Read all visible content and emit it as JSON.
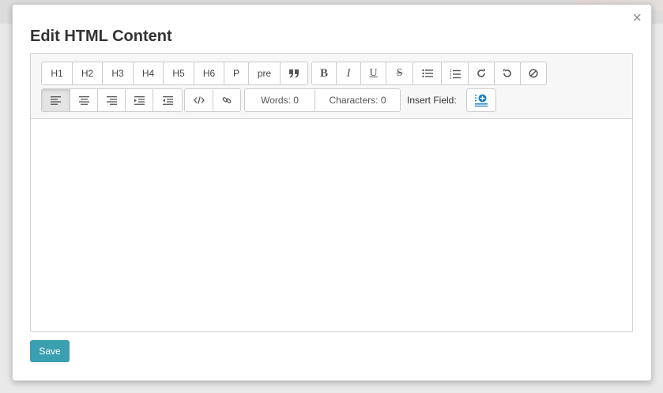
{
  "modal": {
    "title": "Edit HTML Content",
    "close_glyph": "×"
  },
  "toolbar": {
    "headings": [
      "H1",
      "H2",
      "H3",
      "H4",
      "H5",
      "H6",
      "P",
      "pre"
    ],
    "blockquote_icon": "quote-icon",
    "format_icons": [
      "bold-icon",
      "italic-icon",
      "underline-icon",
      "strikethrough-icon",
      "bullet-list-icon",
      "numbered-list-icon",
      "redo-icon",
      "undo-icon",
      "clear-format-icon"
    ],
    "format_glyphs": {
      "bold": "B",
      "italic": "I",
      "underline": "U",
      "strike": "S"
    },
    "align_icons": [
      "align-left-icon",
      "align-center-icon",
      "align-right-icon",
      "indent-icon",
      "outdent-icon"
    ],
    "words_label": "Words: 0",
    "characters_label": "Characters: 0",
    "insert_field_label": "Insert Field:"
  },
  "footer": {
    "save_label": "Save"
  },
  "colors": {
    "accent": "#3a9fb0",
    "insert_icon": "#1a7fc1"
  }
}
